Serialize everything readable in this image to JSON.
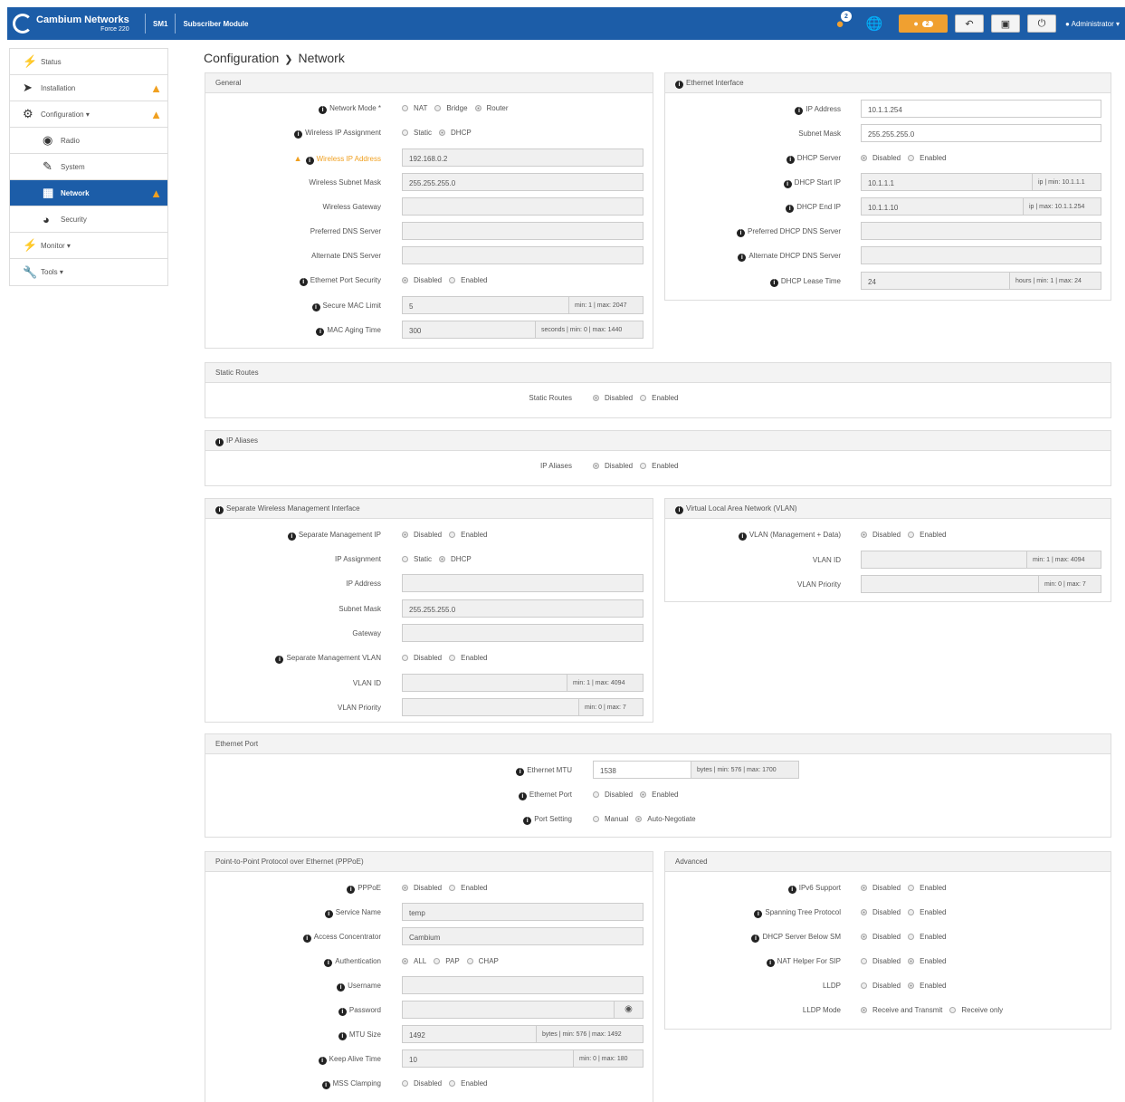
{
  "topbar": {
    "brand": "Cambium Networks",
    "brand_sub": "Force 220",
    "device": "SM1",
    "device_type": "Subscriber Module",
    "notif_count": "2",
    "alert_count": "2",
    "user": "Administrator"
  },
  "sidebar": {
    "items": [
      {
        "label": "Status"
      },
      {
        "label": "Installation"
      },
      {
        "label": "Configuration"
      },
      {
        "label": "Radio"
      },
      {
        "label": "System"
      },
      {
        "label": "Network"
      },
      {
        "label": "Security"
      },
      {
        "label": "Monitor"
      },
      {
        "label": "Tools"
      }
    ]
  },
  "breadcrumb": {
    "parent": "Configuration",
    "current": "Network"
  },
  "general": {
    "title": "General",
    "network_mode": {
      "label": "Network Mode",
      "opts": [
        "NAT",
        "Bridge",
        "Router"
      ]
    },
    "wireless_ip_assign": {
      "label": "Wireless IP Assignment",
      "opts": [
        "Static",
        "DHCP"
      ]
    },
    "wireless_ip": {
      "label": "Wireless IP Address",
      "value": "192.168.0.2"
    },
    "wireless_mask": {
      "label": "Wireless Subnet Mask",
      "value": "255.255.255.0"
    },
    "wireless_gw": {
      "label": "Wireless Gateway",
      "value": ""
    },
    "pref_dns": {
      "label": "Preferred DNS Server",
      "value": ""
    },
    "alt_dns": {
      "label": "Alternate DNS Server",
      "value": ""
    },
    "eth_port_security": {
      "label": "Ethernet Port Security",
      "opts": [
        "Disabled",
        "Enabled"
      ]
    },
    "secure_mac": {
      "label": "Secure MAC Limit",
      "value": "5",
      "suffix": "min: 1 | max: 2047"
    },
    "mac_aging": {
      "label": "MAC Aging Time",
      "value": "300",
      "suffix": "seconds | min: 0 | max: 1440"
    }
  },
  "ethernet_interface": {
    "title": "Ethernet Interface",
    "ip": {
      "label": "IP Address",
      "value": "10.1.1.254"
    },
    "mask": {
      "label": "Subnet Mask",
      "value": "255.255.255.0"
    },
    "dhcp_server": {
      "label": "DHCP Server",
      "opts": [
        "Disabled",
        "Enabled"
      ]
    },
    "dhcp_start": {
      "label": "DHCP Start IP",
      "value": "10.1.1.1",
      "suffix": "ip | min: 10.1.1.1"
    },
    "dhcp_end": {
      "label": "DHCP End IP",
      "value": "10.1.1.10",
      "suffix": "ip | max: 10.1.1.254"
    },
    "pref_dns": {
      "label": "Preferred DHCP DNS Server",
      "value": ""
    },
    "alt_dns": {
      "label": "Alternate DHCP DNS Server",
      "value": ""
    },
    "lease": {
      "label": "DHCP Lease Time",
      "value": "24",
      "suffix": "hours | min: 1 | max: 24"
    }
  },
  "static_routes": {
    "title": "Static Routes",
    "label": "Static Routes",
    "opts": [
      "Disabled",
      "Enabled"
    ]
  },
  "ip_aliases": {
    "title": "IP Aliases",
    "label": "IP Aliases",
    "opts": [
      "Disabled",
      "Enabled"
    ]
  },
  "swmi": {
    "title": "Separate Wireless Management Interface",
    "sep_ip": {
      "label": "Separate Management IP",
      "opts": [
        "Disabled",
        "Enabled"
      ]
    },
    "ip_assign": {
      "label": "IP Assignment",
      "opts": [
        "Static",
        "DHCP"
      ]
    },
    "ip": {
      "label": "IP Address",
      "value": ""
    },
    "mask": {
      "label": "Subnet Mask",
      "value": "255.255.255.0"
    },
    "gw": {
      "label": "Gateway",
      "value": ""
    },
    "sep_vlan": {
      "label": "Separate Management VLAN",
      "opts": [
        "Disabled",
        "Enabled"
      ]
    },
    "vlan_id": {
      "label": "VLAN ID",
      "value": "",
      "suffix": "min: 1 | max: 4094"
    },
    "vlan_pri": {
      "label": "VLAN Priority",
      "value": "",
      "suffix": "min: 0 | max: 7"
    }
  },
  "vlan": {
    "title": "Virtual Local Area Network (VLAN)",
    "mgmt": {
      "label": "VLAN (Management + Data)",
      "opts": [
        "Disabled",
        "Enabled"
      ]
    },
    "vlan_id": {
      "label": "VLAN ID",
      "value": "",
      "suffix": "min: 1 | max: 4094"
    },
    "vlan_pri": {
      "label": "VLAN Priority",
      "value": "",
      "suffix": "min: 0 | max: 7"
    }
  },
  "eth_port": {
    "title": "Ethernet Port",
    "mtu": {
      "label": "Ethernet MTU",
      "value": "1538",
      "suffix": "bytes | min: 576 | max: 1700"
    },
    "port": {
      "label": "Ethernet Port",
      "opts": [
        "Disabled",
        "Enabled"
      ]
    },
    "setting": {
      "label": "Port Setting",
      "opts": [
        "Manual",
        "Auto-Negotiate"
      ]
    }
  },
  "pppoe": {
    "title": "Point-to-Point Protocol over Ethernet (PPPoE)",
    "pppoe": {
      "label": "PPPoE",
      "opts": [
        "Disabled",
        "Enabled"
      ]
    },
    "service": {
      "label": "Service Name",
      "value": "temp"
    },
    "ac": {
      "label": "Access Concentrator",
      "value": "Cambium"
    },
    "auth": {
      "label": "Authentication",
      "opts": [
        "ALL",
        "PAP",
        "CHAP"
      ]
    },
    "user": {
      "label": "Username",
      "value": ""
    },
    "pass": {
      "label": "Password",
      "value": ""
    },
    "mtu": {
      "label": "MTU Size",
      "value": "1492",
      "suffix": "bytes | min: 576 | max: 1492"
    },
    "keepalive": {
      "label": "Keep Alive Time",
      "value": "10",
      "suffix": "min: 0 | max: 180"
    },
    "mss": {
      "label": "MSS Clamping",
      "opts": [
        "Disabled",
        "Enabled"
      ]
    }
  },
  "advanced": {
    "title": "Advanced",
    "ipv6": {
      "label": "IPv6 Support",
      "opts": [
        "Disabled",
        "Enabled"
      ]
    },
    "stp": {
      "label": "Spanning Tree Protocol",
      "opts": [
        "Disabled",
        "Enabled"
      ]
    },
    "dhcp_below": {
      "label": "DHCP Server Below SM",
      "opts": [
        "Disabled",
        "Enabled"
      ]
    },
    "nat_sip": {
      "label": "NAT Helper For SIP",
      "opts": [
        "Disabled",
        "Enabled"
      ]
    },
    "lldp": {
      "label": "LLDP",
      "opts": [
        "Disabled",
        "Enabled"
      ]
    },
    "lldp_mode": {
      "label": "LLDP Mode",
      "opts": [
        "Receive and Transmit",
        "Receive only"
      ]
    }
  }
}
